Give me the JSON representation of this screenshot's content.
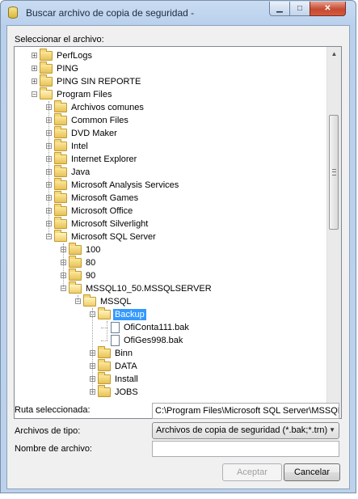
{
  "window": {
    "title": "Buscar archivo de copia de seguridad -",
    "minimize_glyph": "▁",
    "maximize_glyph": "□",
    "close_glyph": "✕",
    "title_icon": "database-cylinder-icon"
  },
  "tree_label": "Seleccionar el archivo:",
  "tree": {
    "items": [
      {
        "label": "PerfLogs",
        "level": 1,
        "expander": "+",
        "icon": "folder"
      },
      {
        "label": "PING",
        "level": 1,
        "expander": "+",
        "icon": "folder"
      },
      {
        "label": "PING SIN REPORTE",
        "level": 1,
        "expander": "+",
        "icon": "folder"
      },
      {
        "label": "Program Files",
        "level": 1,
        "expander": "-",
        "icon": "folder-open"
      },
      {
        "label": "Archivos comunes",
        "level": 2,
        "expander": "+",
        "icon": "folder"
      },
      {
        "label": "Common Files",
        "level": 2,
        "expander": "+",
        "icon": "folder"
      },
      {
        "label": "DVD Maker",
        "level": 2,
        "expander": "+",
        "icon": "folder"
      },
      {
        "label": "Intel",
        "level": 2,
        "expander": "+",
        "icon": "folder"
      },
      {
        "label": "Internet Explorer",
        "level": 2,
        "expander": "+",
        "icon": "folder"
      },
      {
        "label": "Java",
        "level": 2,
        "expander": "+",
        "icon": "folder"
      },
      {
        "label": "Microsoft Analysis Services",
        "level": 2,
        "expander": "+",
        "icon": "folder"
      },
      {
        "label": "Microsoft Games",
        "level": 2,
        "expander": "+",
        "icon": "folder"
      },
      {
        "label": "Microsoft Office",
        "level": 2,
        "expander": "+",
        "icon": "folder"
      },
      {
        "label": "Microsoft Silverlight",
        "level": 2,
        "expander": "+",
        "icon": "folder"
      },
      {
        "label": "Microsoft SQL Server",
        "level": 2,
        "expander": "-",
        "icon": "folder-open"
      },
      {
        "label": "100",
        "level": 3,
        "expander": "+",
        "icon": "folder"
      },
      {
        "label": "80",
        "level": 3,
        "expander": "+",
        "icon": "folder"
      },
      {
        "label": "90",
        "level": 3,
        "expander": "+",
        "icon": "folder"
      },
      {
        "label": "MSSQL10_50.MSSQLSERVER",
        "level": 3,
        "expander": "-",
        "icon": "folder-open"
      },
      {
        "label": "MSSQL",
        "level": 4,
        "expander": "-",
        "icon": "folder-open"
      },
      {
        "label": "Backup",
        "level": 5,
        "expander": "-",
        "icon": "folder-open",
        "selected": true
      },
      {
        "label": "OfiConta111.bak",
        "level": 6,
        "expander": "",
        "icon": "file"
      },
      {
        "label": "OfiGes998.bak",
        "level": 6,
        "expander": "",
        "icon": "file"
      },
      {
        "label": "Binn",
        "level": 5,
        "expander": "+",
        "icon": "folder"
      },
      {
        "label": "DATA",
        "level": 5,
        "expander": "+",
        "icon": "folder"
      },
      {
        "label": "Install",
        "level": 5,
        "expander": "+",
        "icon": "folder"
      },
      {
        "label": "JOBS",
        "level": 5,
        "expander": "+",
        "icon": "folder"
      }
    ]
  },
  "scrollbar": {
    "up_glyph": "▲",
    "down_glyph": "▼"
  },
  "form": {
    "path_label": "Ruta seleccionada:",
    "path_value": "C:\\Program Files\\Microsoft SQL Server\\MSSQL",
    "filetype_label": "Archivos de tipo:",
    "filetype_value": "Archivos de copia de seguridad (*.bak;*.trn)",
    "filetype_arrow": "▼",
    "filename_label": "Nombre de archivo:",
    "filename_value": ""
  },
  "buttons": {
    "accept": "Aceptar",
    "cancel": "Cancelar"
  },
  "colors": {
    "selection": "#3399ff",
    "title_bar": "#c9dcf2",
    "close_button": "#c54a31"
  }
}
